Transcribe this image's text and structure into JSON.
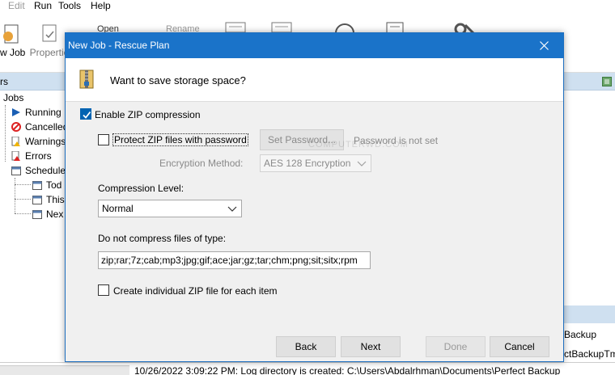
{
  "app": {
    "menu": [
      "Edit",
      "Run",
      "Tools",
      "Help"
    ],
    "toolbar": {
      "new_job_label": "w Job",
      "properties_label": "Propertie",
      "open_label": "Open",
      "rename_label": "Rename"
    },
    "left_panel_header": "rs",
    "tree": {
      "root": "Jobs",
      "items": [
        "Running",
        "Cancelled",
        "Warnings",
        "Errors",
        "Scheduled"
      ],
      "scheduled_children": [
        "Tod",
        "This",
        "Nex"
      ]
    },
    "right_lower_lines": [
      "Backup",
      "ctBackupTmp"
    ],
    "log_line": "10/26/2022 3:09:22 PM: Log directory is created: C:\\Users\\Abdalrhman\\Documents\\Perfect Backup"
  },
  "dialog": {
    "title": "New Job - Rescue Plan",
    "header_question": "Want to save storage space?",
    "enable_zip": {
      "label": "Enable ZIP compression",
      "checked": true
    },
    "protect_zip": {
      "label": "Protect ZIP files with password",
      "checked": false
    },
    "set_password_button": "Set Password...",
    "password_status": "Password is not set",
    "encryption_method_label": "Encryption Method:",
    "encryption_method_value": "AES 128 Encryption",
    "compression_level_label": "Compression Level:",
    "compression_level_value": "Normal",
    "exclude_types_label": "Do not compress files of type:",
    "exclude_types_value": "zip;rar;7z;cab;mp3;jpg;gif;ace;jar;gz;tar;chm;png;sit;sitx;rpm",
    "individual_zip": {
      "label": "Create individual ZIP file for each item",
      "checked": false
    },
    "buttons": {
      "back": "Back",
      "next": "Next",
      "done": "Done",
      "cancel": "Cancel"
    },
    "watermark": "COMPUTERWD.COM"
  },
  "colors": {
    "title_bar": "#1a73c9",
    "check_accent": "#0063b1",
    "panel_header": "#cfe0f0"
  }
}
